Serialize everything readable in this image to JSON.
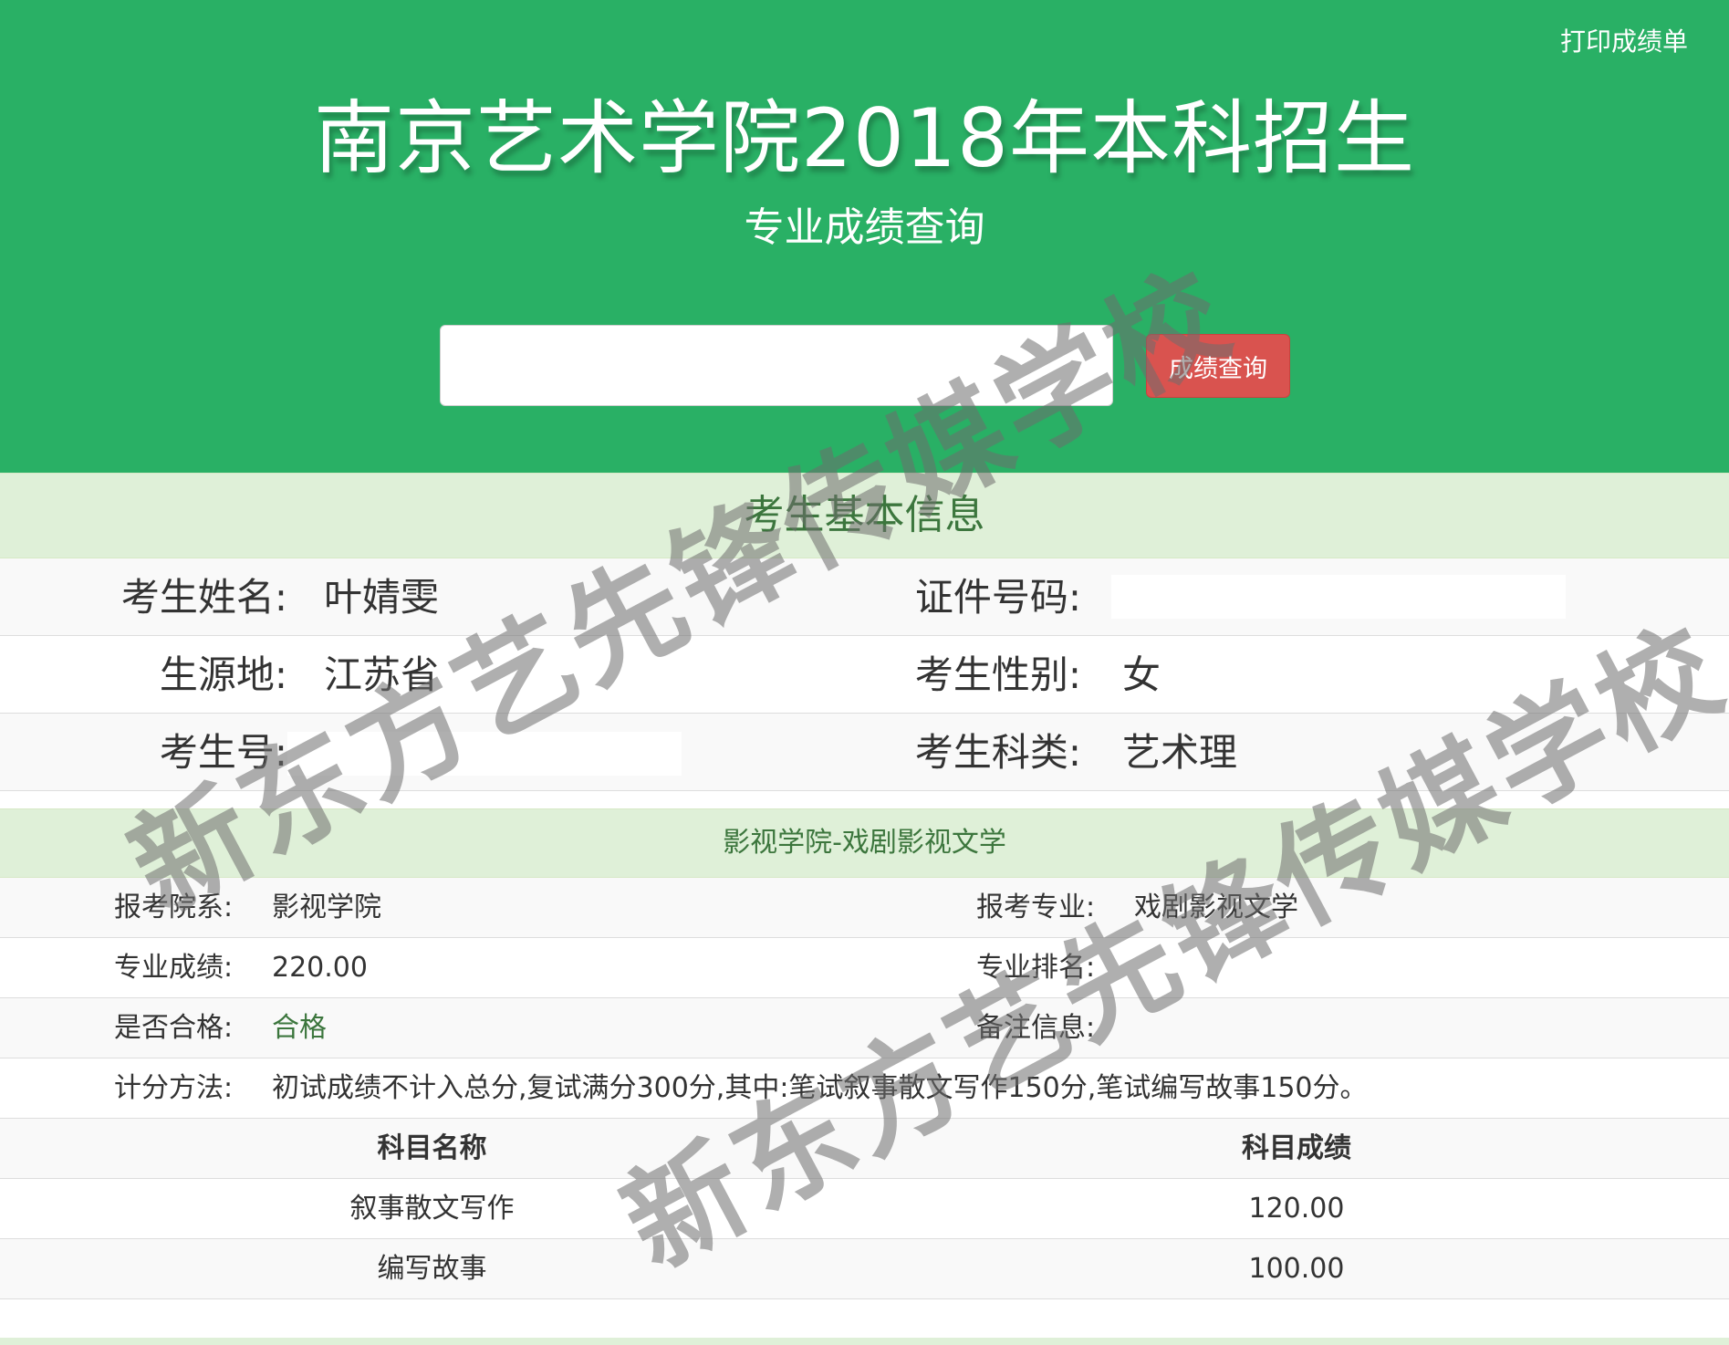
{
  "header": {
    "print_label": "打印成绩单",
    "title": "南京艺术学院2018年本科招生",
    "subtitle": "专业成绩查询",
    "search_value": "",
    "search_button": "成绩查询",
    "bg_color": "#29b065",
    "button_color": "#d9534f"
  },
  "basic": {
    "title": "考生基本信息",
    "name_label": "考生姓名:",
    "name_value": "叶婧雯",
    "id_label": "证件号码:",
    "origin_label": "生源地:",
    "origin_value": "江苏省",
    "gender_label": "考生性别:",
    "gender_value": "女",
    "exam_no_label": "考生号:",
    "category_label": "考生科类:",
    "category_value": "艺术理"
  },
  "major": {
    "title": "影视学院-戏剧影视文学",
    "dept_label": "报考院系:",
    "dept_value": "影视学院",
    "major_label": "报考专业:",
    "major_value": "戏剧影视文学",
    "score_label": "专业成绩:",
    "score_value": "220.00",
    "rank_label": "专业排名:",
    "pass_label": "是否合格:",
    "pass_value": "合格",
    "remark_label": "备注信息:",
    "method_label": "计分方法:",
    "method_value": "初试成绩不计入总分,复试满分300分,其中:笔试叙事散文写作150分,笔试编写故事150分。"
  },
  "scores": {
    "headers": [
      "科目名称",
      "科目成绩"
    ],
    "rows": [
      [
        "叙事散文写作",
        "120.00"
      ],
      [
        "编写故事",
        "100.00"
      ]
    ]
  },
  "watermark": "新东方艺先锋传媒学校"
}
